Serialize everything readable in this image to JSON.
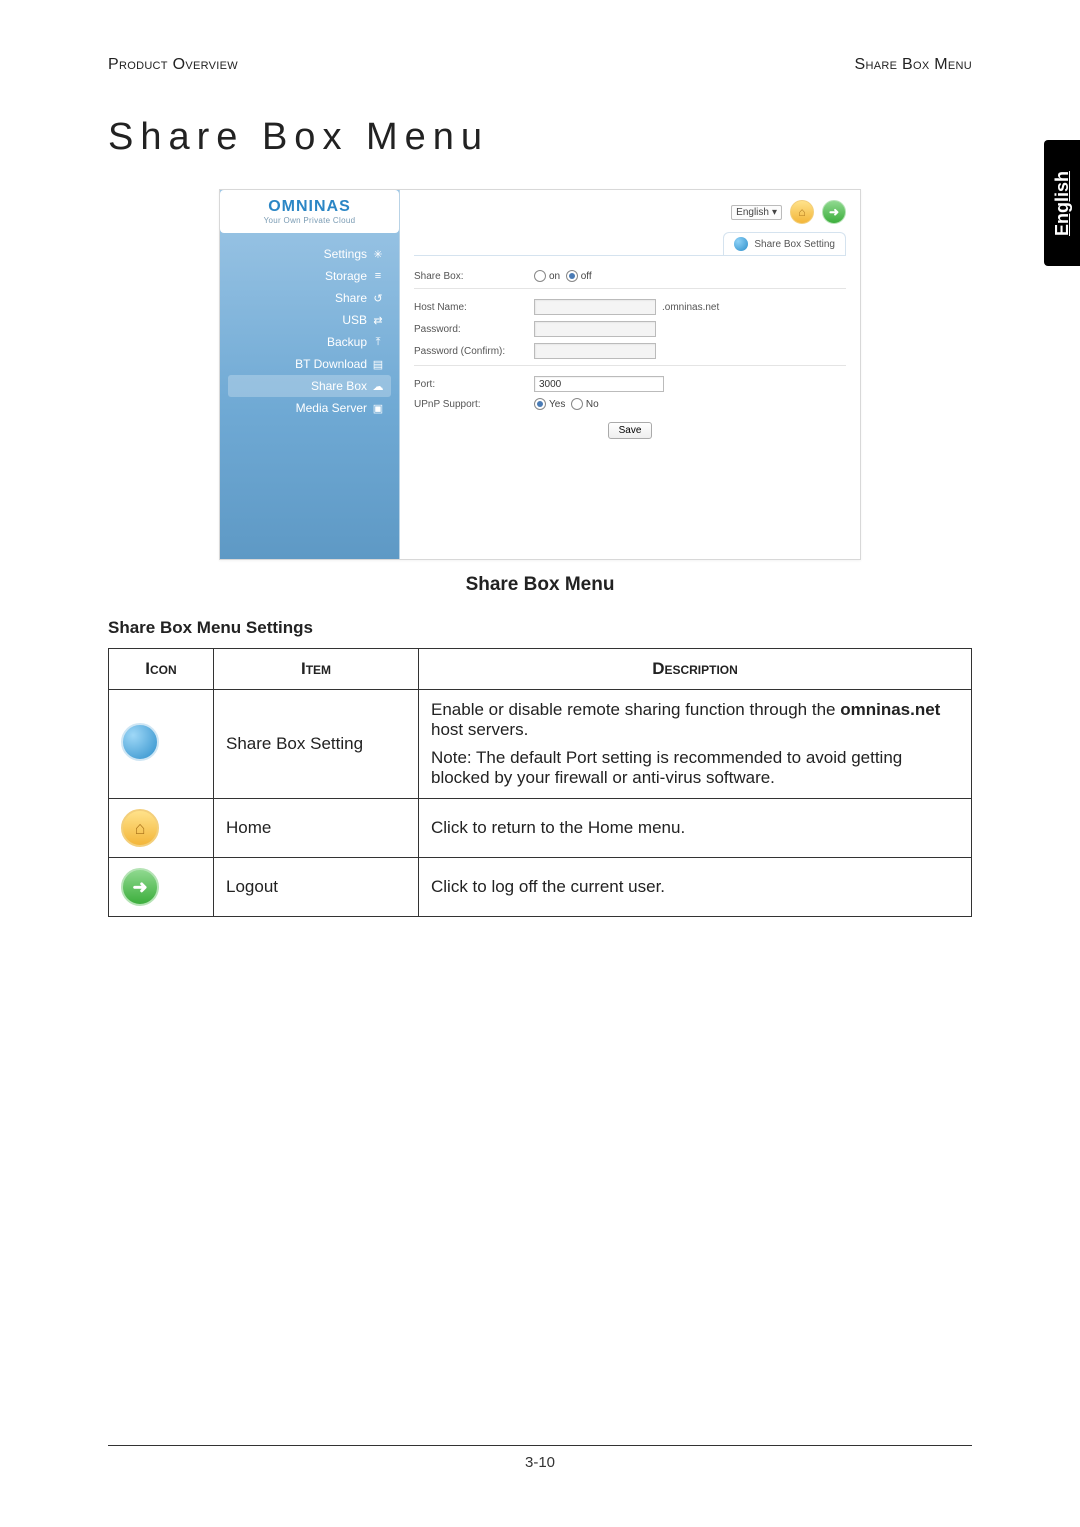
{
  "header": {
    "left": "Product Overview",
    "right": "Share Box Menu"
  },
  "side_tab": "English",
  "title": "Share Box Menu",
  "screenshot": {
    "brand": "OMNINAS",
    "tagline": "Your Own Private Cloud",
    "nav": [
      {
        "label": "Settings",
        "icon": "✳"
      },
      {
        "label": "Storage",
        "icon": "≡"
      },
      {
        "label": "Share",
        "icon": "↺"
      },
      {
        "label": "USB",
        "icon": "⇄"
      },
      {
        "label": "Backup",
        "icon": "⤒"
      },
      {
        "label": "BT Download",
        "icon": "▤"
      },
      {
        "label": "Share Box",
        "icon": "☁",
        "selected": true
      },
      {
        "label": "Media Server",
        "icon": "▣"
      }
    ],
    "lang": {
      "value": "English"
    },
    "tab_title": "Share Box Setting",
    "form": {
      "sharebox_label": "Share Box:",
      "on_label": "on",
      "off_label": "off",
      "hostname_label": "Host Name:",
      "hostname_suffix": ".omninas.net",
      "password_label": "Password:",
      "password_confirm_label": "Password (Confirm):",
      "port_label": "Port:",
      "port_value": "3000",
      "upnp_label": "UPnP Support:",
      "yes": "Yes",
      "no": "No",
      "save": "Save"
    }
  },
  "caption": "Share Box Menu",
  "table_caption": "Share Box Menu Settings",
  "table": {
    "headers": {
      "icon": "Icon",
      "item": "Item",
      "desc": "Description"
    },
    "rows": [
      {
        "item": "Share Box Setting",
        "desc_pre": "Enable or disable remote sharing function through the ",
        "desc_bold": "omninas.net",
        "desc_post": " host servers.",
        "note": "Note: The default Port setting is recommended to avoid getting blocked by your firewall or anti-virus software."
      },
      {
        "item": "Home",
        "desc": "Click to return to the Home menu."
      },
      {
        "item": "Logout",
        "desc": "Click to log off the current user."
      }
    ]
  },
  "page_number": "3-10"
}
